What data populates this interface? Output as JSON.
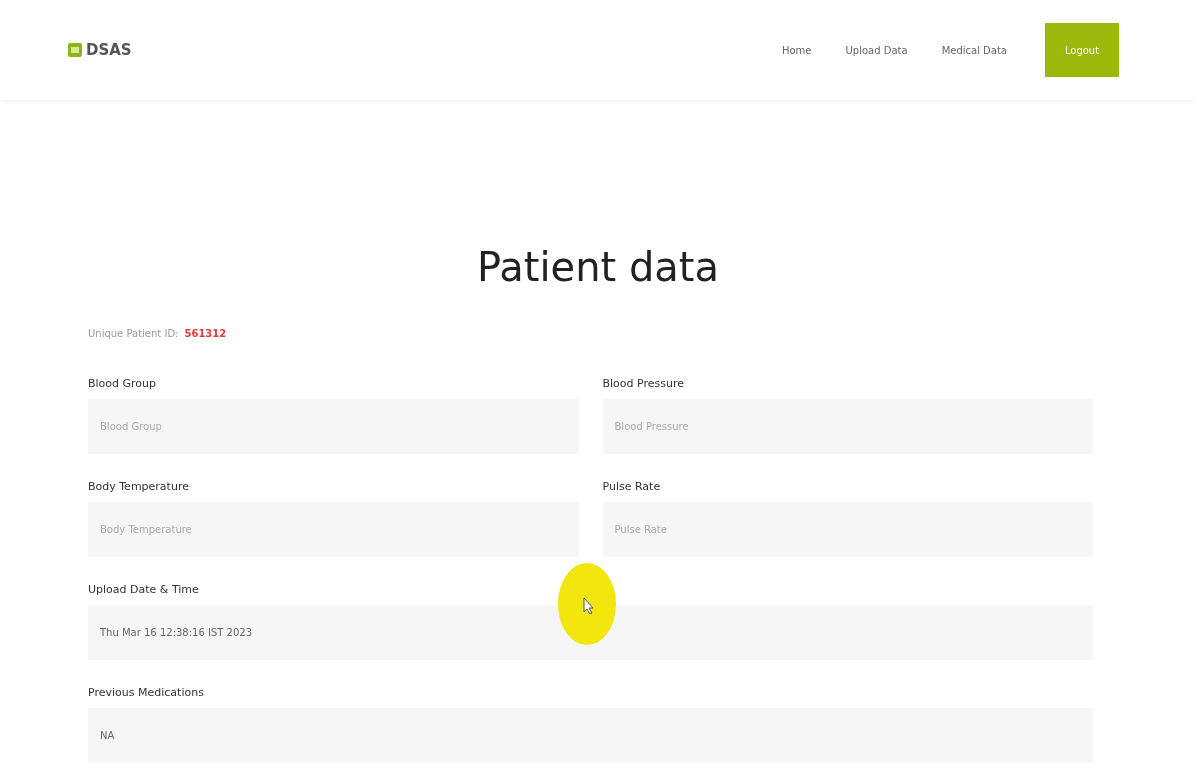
{
  "brand": {
    "name": "DSAS"
  },
  "nav": {
    "links": [
      {
        "label": "Home"
      },
      {
        "label": "Upload Data"
      },
      {
        "label": "Medical Data"
      }
    ],
    "button": "Logout"
  },
  "page_title": "Patient data",
  "patient_id": {
    "label": "Unique Patient ID:",
    "value": "561312"
  },
  "fields": [
    {
      "label": "Blood Group",
      "placeholder": "Blood Group",
      "kind": "half"
    },
    {
      "label": "Blood Pressure",
      "placeholder": "Blood Pressure",
      "kind": "half"
    },
    {
      "label": "Body Temperature",
      "placeholder": "Body Temperature",
      "kind": "half"
    },
    {
      "label": "Pulse Rate",
      "placeholder": "Pulse Rate",
      "kind": "half"
    },
    {
      "label": "Upload Date & Time",
      "value": "Thu Mar 16 12:38:16 IST 2023",
      "kind": "full"
    },
    {
      "label": "Previous Medications",
      "value": "NA",
      "kind": "full"
    }
  ]
}
